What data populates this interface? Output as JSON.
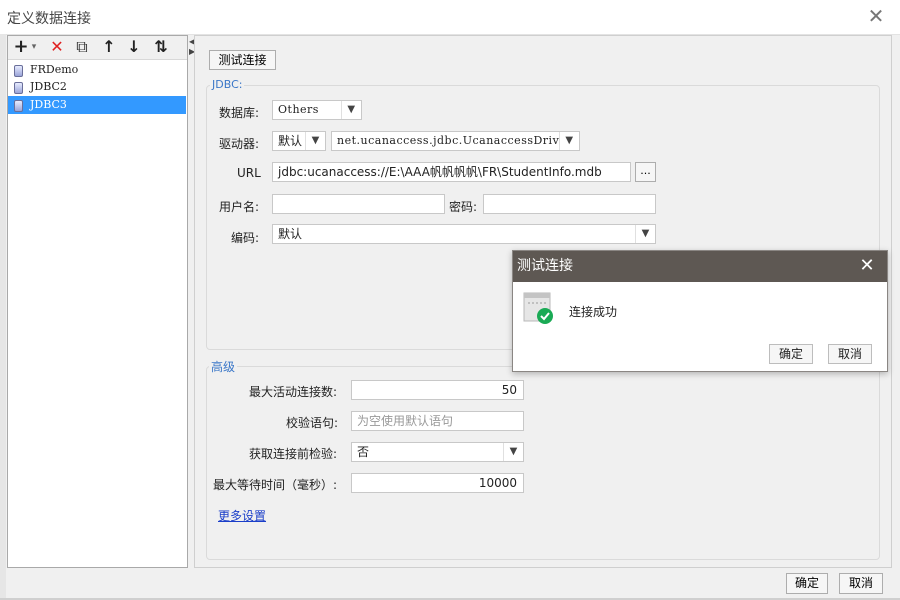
{
  "window": {
    "title": "定义数据连接",
    "close_glyph": "✕"
  },
  "toolbar": {
    "add": "+",
    "add_menu": "▾",
    "delete": "✕",
    "copy": "⧉",
    "up": "↑",
    "down": "↓",
    "sort": "⇅"
  },
  "tree": {
    "items": [
      {
        "label": "FRDemo"
      },
      {
        "label": "JDBC2"
      },
      {
        "label": "JDBC3",
        "selected": true
      }
    ]
  },
  "main": {
    "test_button": "测试连接",
    "jdbc_section": "JDBC:",
    "database_label": "数据库:",
    "database_value": "Others",
    "driver_label": "驱动器:",
    "driver_mode": "默认",
    "driver_class": "net.ucanaccess.jdbc.UcanaccessDriver",
    "url_label": "URL",
    "url_value": "jdbc:ucanaccess://E:\\AAA帆帆帆帆\\FR\\StudentInfo.mdb",
    "url_browse": "...",
    "user_label": "用户名:",
    "user_value": "",
    "password_label": "密码:",
    "password_value": "",
    "encoding_label": "编码:",
    "encoding_value": "默认",
    "advanced_section": "高级",
    "max_active_label": "最大活动连接数:",
    "max_active_value": "50",
    "validation_label": "校验语句:",
    "validation_placeholder": "为空使用默认语句",
    "test_before_label": "获取连接前检验:",
    "test_before_value": "否",
    "max_wait_label": "最大等待时间（毫秒）:",
    "max_wait_value": "10000",
    "more_settings": "更多设置"
  },
  "footer": {
    "ok": "确定",
    "cancel": "取消"
  },
  "dialog": {
    "title": "测试连接",
    "close_glyph": "✕",
    "message": "连接成功",
    "ok": "确定",
    "cancel": "取消"
  },
  "colors": {
    "selection": "#3399ff",
    "dialog_title_bg": "#5e5853",
    "section_label": "#3b77c8",
    "delete_icon": "#e02020",
    "success_icon": "#1aaa55",
    "link": "#1a3ec9"
  }
}
